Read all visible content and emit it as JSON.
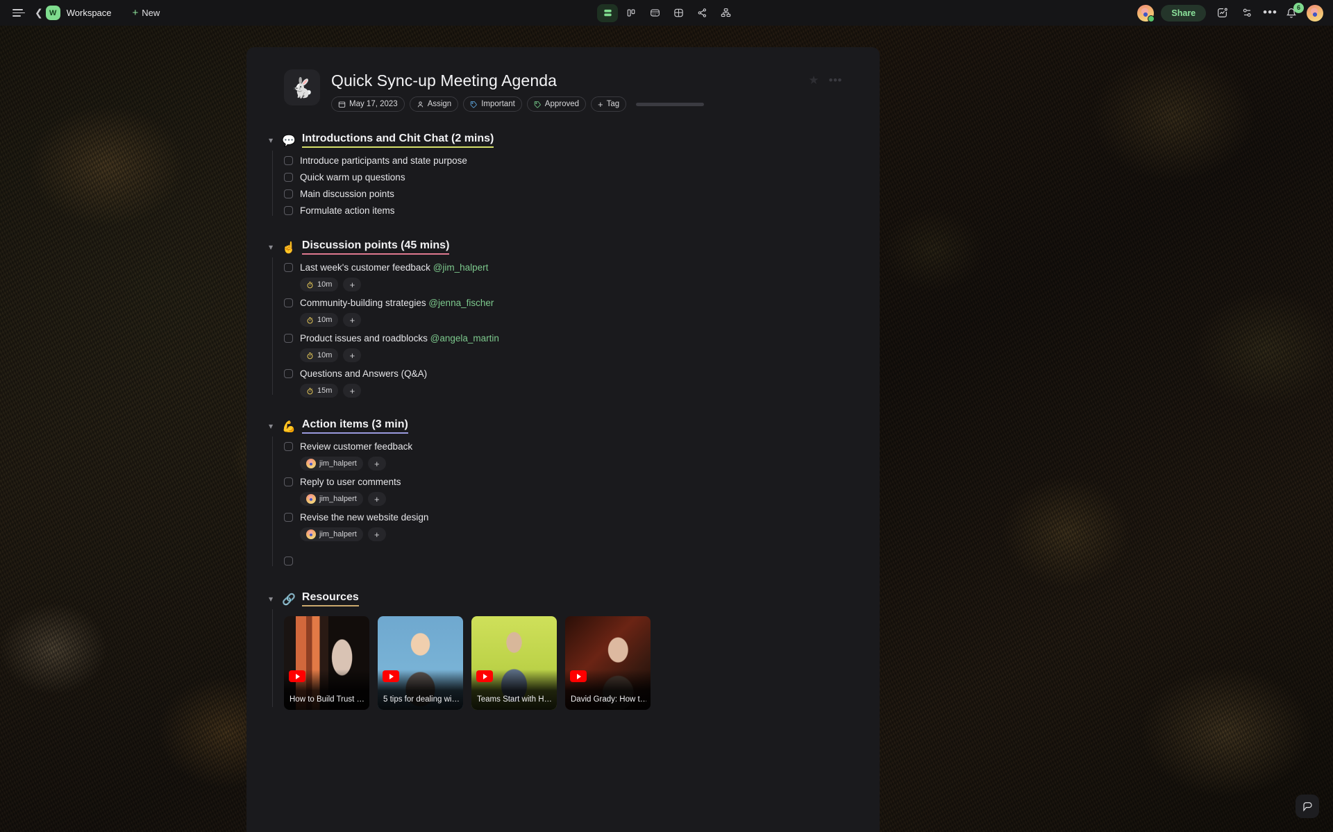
{
  "topbar": {
    "menu_icon": "hamburger-icon",
    "back_icon": "chevron-left-icon",
    "workspace_initial": "W",
    "workspace_name": "Workspace",
    "new_label": "New",
    "views": [
      {
        "name": "list-view",
        "icon": "list-view-icon",
        "active": true
      },
      {
        "name": "board-view",
        "icon": "board-view-icon",
        "active": false
      },
      {
        "name": "calendar-view",
        "icon": "calendar-view-icon",
        "active": false
      },
      {
        "name": "table-view",
        "icon": "table-view-icon",
        "active": false
      },
      {
        "name": "share-graph-view",
        "icon": "share-nodes-icon",
        "active": false
      },
      {
        "name": "org-chart-view",
        "icon": "hierarchy-icon",
        "active": false
      }
    ],
    "share_label": "Share",
    "activity_icon": "activity-chart-icon",
    "filter_icon": "settings-sliders-icon",
    "more_icon": "more-horizontal-icon",
    "bell_icon": "notification-bell-icon",
    "bell_badge": "6",
    "accent_green": "#8ce39c"
  },
  "doc": {
    "emoji": "🐇",
    "title": "Quick Sync-up Meeting Agenda",
    "star_icon": "star-icon",
    "more_icon": "more-horizontal-icon",
    "chips": [
      {
        "label": "May 17, 2023",
        "icon": "calendar-icon",
        "color": "#d8d8db"
      },
      {
        "label": "Assign",
        "icon": "person-icon",
        "color": "#d8d8db"
      },
      {
        "label": "Important",
        "icon": "tag-icon",
        "color": "#5b9fd4"
      },
      {
        "label": "Approved",
        "icon": "tag-icon",
        "color": "#6fbf82"
      },
      {
        "label": "Tag",
        "icon": "plus-icon",
        "color": "#d8d8db"
      }
    ],
    "sections": [
      {
        "emoji": "💬",
        "title": "Introductions and Chit Chat (2 mins)",
        "underline": "#d6e06a",
        "items": [
          {
            "text": "Introduce participants and state purpose",
            "mention": "",
            "meta": []
          },
          {
            "text": "Quick warm up questions",
            "mention": "",
            "meta": []
          },
          {
            "text": "Main discussion points",
            "mention": "",
            "meta": []
          },
          {
            "text": "Formulate action items",
            "mention": "",
            "meta": []
          }
        ]
      },
      {
        "emoji": "☝️",
        "title": "Discussion points (45 mins)",
        "underline": "#e0798f",
        "items": [
          {
            "text": "Last week's customer feedback",
            "mention": "@jim_halpert",
            "meta": [
              {
                "type": "timer",
                "label": "10m"
              }
            ]
          },
          {
            "text": "Community-building strategies",
            "mention": "@jenna_fischer",
            "meta": [
              {
                "type": "timer",
                "label": "10m"
              }
            ]
          },
          {
            "text": "Product issues and roadblocks",
            "mention": "@angela_martin",
            "meta": [
              {
                "type": "timer",
                "label": "10m"
              }
            ]
          },
          {
            "text": "Questions and Answers (Q&A)",
            "mention": "",
            "meta": [
              {
                "type": "timer",
                "label": "15m"
              }
            ]
          }
        ]
      },
      {
        "emoji": "💪",
        "title": "Action items (3 min)",
        "underline": "#9a9ade",
        "items": [
          {
            "text": "Review customer feedback",
            "mention": "",
            "meta": [
              {
                "type": "assignee",
                "label": "jim_halpert"
              }
            ]
          },
          {
            "text": "Reply to user comments",
            "mention": "",
            "meta": [
              {
                "type": "assignee",
                "label": "jim_halpert"
              }
            ]
          },
          {
            "text": "Revise the new website design",
            "mention": "",
            "meta": [
              {
                "type": "assignee",
                "label": "jim_halpert"
              }
            ]
          },
          {
            "text": "",
            "mention": "",
            "meta": []
          }
        ]
      },
      {
        "emoji": "🔗",
        "title": "Resources",
        "underline": "#cdaa6d",
        "items": [],
        "cards": [
          {
            "title": "How to Build Trust …",
            "source": "youtube"
          },
          {
            "title": "5 tips for dealing wi…",
            "source": "youtube"
          },
          {
            "title": "Teams Start with H…",
            "source": "youtube"
          },
          {
            "title": "David Grady: How t…",
            "source": "youtube"
          }
        ]
      }
    ]
  },
  "fab": {
    "icon": "chat-bubble-icon"
  }
}
